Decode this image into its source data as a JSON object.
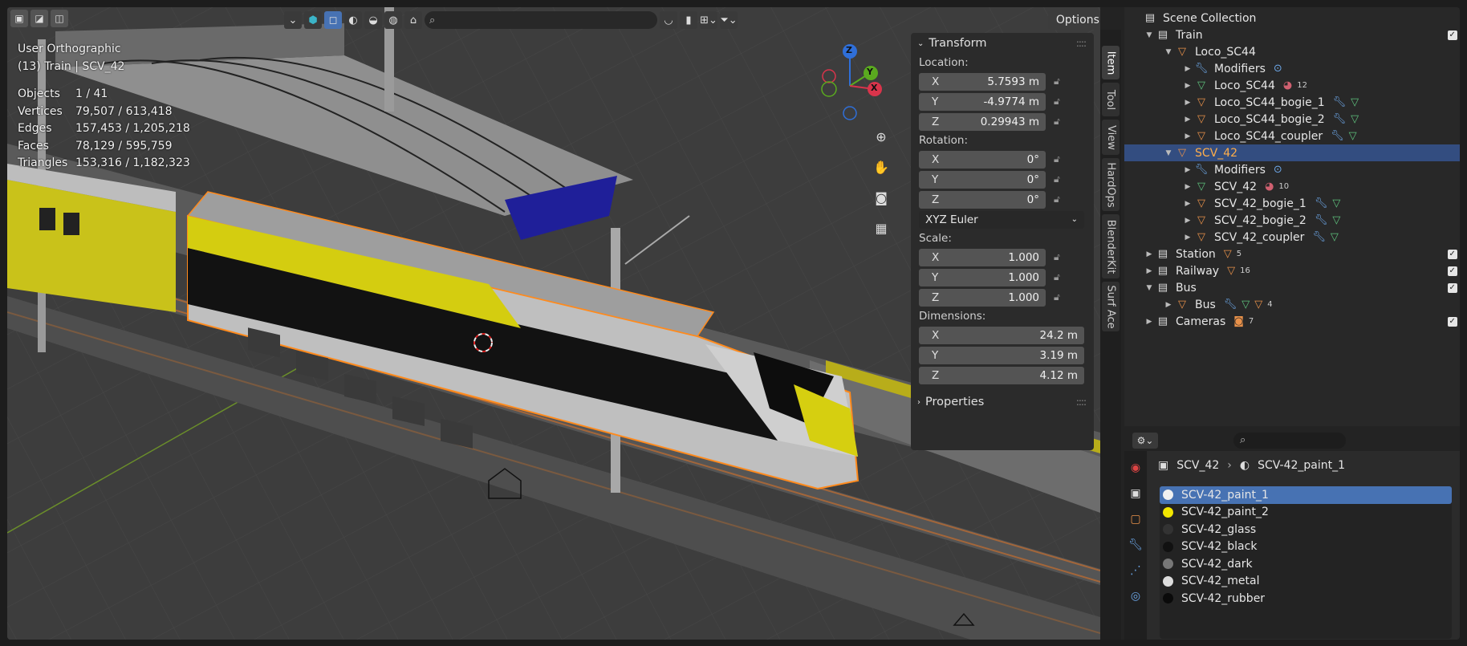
{
  "viewport": {
    "view_name": "User Orthographic",
    "context": "(13) Train | SCV_42",
    "stats": [
      {
        "label": "Objects",
        "value": "1 / 41"
      },
      {
        "label": "Vertices",
        "value": "79,507 / 613,418"
      },
      {
        "label": "Edges",
        "value": "157,453 / 1,205,218"
      },
      {
        "label": "Faces",
        "value": "78,129 / 595,759"
      },
      {
        "label": "Triangles",
        "value": "153,316 / 1,182,323"
      }
    ],
    "options_label": "Options",
    "gizmo": {
      "z": "Z",
      "y": "Y",
      "x": "X"
    }
  },
  "npanel": {
    "transform_title": "Transform",
    "location_label": "Location:",
    "location": [
      {
        "axis": "X",
        "value": "5.7593 m"
      },
      {
        "axis": "Y",
        "value": "-4.9774 m"
      },
      {
        "axis": "Z",
        "value": "0.29943 m"
      }
    ],
    "rotation_label": "Rotation:",
    "rotation": [
      {
        "axis": "X",
        "value": "0°"
      },
      {
        "axis": "Y",
        "value": "0°"
      },
      {
        "axis": "Z",
        "value": "0°"
      }
    ],
    "rotation_mode": "XYZ Euler",
    "scale_label": "Scale:",
    "scale": [
      {
        "axis": "X",
        "value": "1.000"
      },
      {
        "axis": "Y",
        "value": "1.000"
      },
      {
        "axis": "Z",
        "value": "1.000"
      }
    ],
    "dimensions_label": "Dimensions:",
    "dimensions": [
      {
        "axis": "X",
        "value": "24.2 m"
      },
      {
        "axis": "Y",
        "value": "3.19 m"
      },
      {
        "axis": "Z",
        "value": "4.12 m"
      }
    ],
    "properties_title": "Properties"
  },
  "side_tabs": [
    "Item",
    "Tool",
    "View",
    "HardOps",
    "BlenderKit",
    "Surf Ace"
  ],
  "outliner": {
    "root": "Scene Collection",
    "rows": [
      {
        "name": "Train"
      },
      {
        "name": "Loco_SC44"
      },
      {
        "name": "Modifiers"
      },
      {
        "name": "Loco_SC44",
        "count": "12"
      },
      {
        "name": "Loco_SC44_bogie_1"
      },
      {
        "name": "Loco_SC44_bogie_2"
      },
      {
        "name": "Loco_SC44_coupler"
      },
      {
        "name": "SCV_42"
      },
      {
        "name": "Modifiers"
      },
      {
        "name": "SCV_42",
        "count": "10"
      },
      {
        "name": "SCV_42_bogie_1"
      },
      {
        "name": "SCV_42_bogie_2"
      },
      {
        "name": "SCV_42_coupler"
      },
      {
        "name": "Station",
        "count": "5"
      },
      {
        "name": "Railway",
        "count": "16"
      },
      {
        "name": "Bus"
      },
      {
        "name": "Bus",
        "count": "4"
      },
      {
        "name": "Cameras",
        "count": "7"
      }
    ]
  },
  "properties": {
    "breadcrumb_object": "SCV_42",
    "breadcrumb_material": "SCV-42_paint_1",
    "materials": [
      {
        "name": "SCV-42_paint_1",
        "color": "#f0f0f0"
      },
      {
        "name": "SCV-42_paint_2",
        "color": "#f2e600"
      },
      {
        "name": "SCV-42_glass",
        "color": "#333333"
      },
      {
        "name": "SCV-42_black",
        "color": "#111111"
      },
      {
        "name": "SCV-42_dark",
        "color": "#777777"
      },
      {
        "name": "SCV-42_metal",
        "color": "#dddddd"
      },
      {
        "name": "SCV-42_rubber",
        "color": "#0a0a0a"
      }
    ]
  }
}
